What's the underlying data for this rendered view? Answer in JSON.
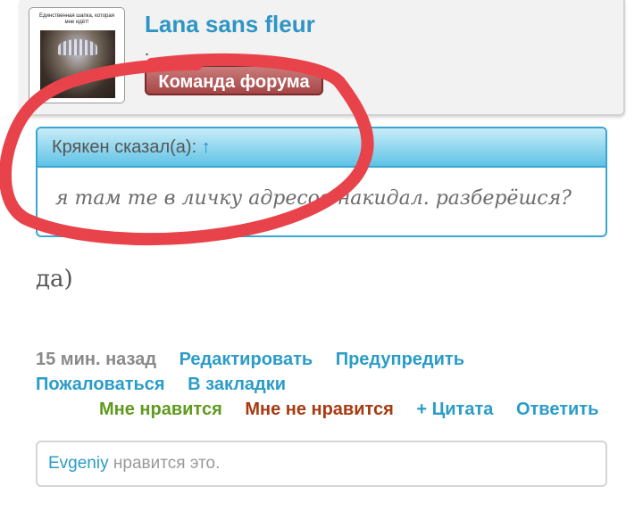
{
  "author": {
    "name": "Lana sans fleur",
    "dot": ".",
    "team_badge": "Команда форума",
    "avatar_caption": "Единственная шапка, которая мне идёт!"
  },
  "quote": {
    "author": "Крякен сказал(а):",
    "arrow": "↑",
    "text": "я там те в личку адресов накидал. разберёшся?"
  },
  "post": {
    "text": "да)"
  },
  "actions": {
    "time": "15 мин. назад",
    "edit": "Редактировать",
    "warn": "Предупредить",
    "report": "Пожаловаться",
    "bookmark": "В закладки",
    "like": "Мне нравится",
    "dislike": "Мне не нравится",
    "quote": "+ Цитата",
    "reply": "Ответить"
  },
  "likes": {
    "user": "Evgeniy",
    "text": "нравится это."
  },
  "colors": {
    "link": "#2a9cc8",
    "like": "#5f9a1e",
    "dislike": "#a63a10",
    "marker": "#e8434a"
  }
}
